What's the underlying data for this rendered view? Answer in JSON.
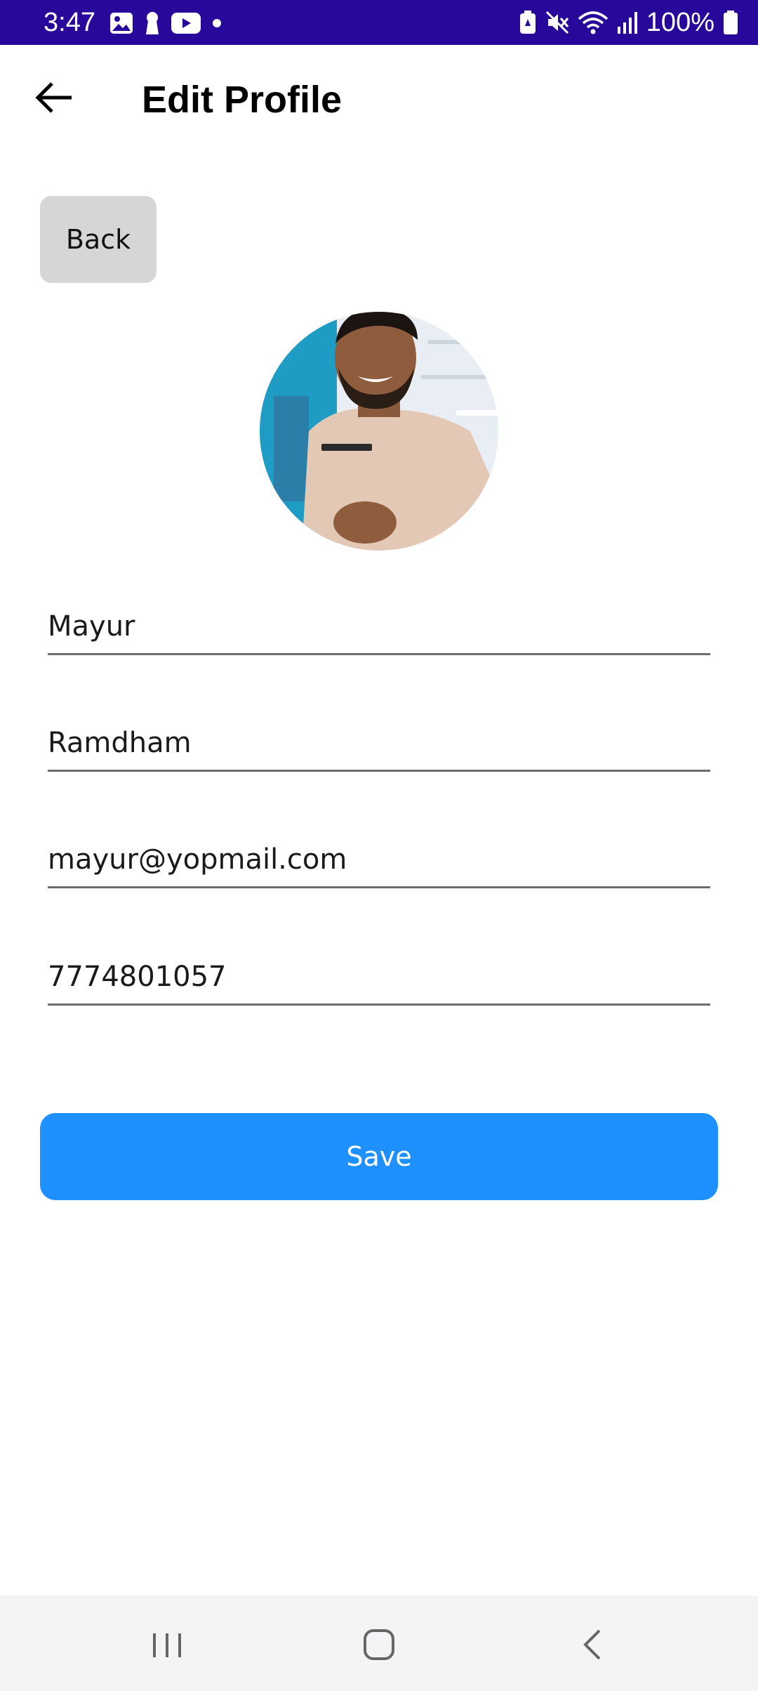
{
  "status_bar": {
    "time": "3:47",
    "battery": "100%",
    "left_icons": [
      "gallery-icon",
      "keyhole-icon",
      "youtube-icon",
      "dot-icon"
    ],
    "right_icons": [
      "battery-saver-icon",
      "mute-icon",
      "wifi-icon",
      "signal-icon",
      "battery-icon"
    ],
    "background": "#27089b"
  },
  "app_bar": {
    "title": "Edit Profile"
  },
  "back_button": {
    "label": "Back"
  },
  "form": {
    "first_name": "Mayur",
    "last_name": "Ramdham",
    "email": "mayur@yopmail.com",
    "phone": "7774801057"
  },
  "save_button": {
    "label": "Save",
    "color": "#1e90ff"
  },
  "nav_bar": {
    "items": [
      "recents-icon",
      "home-icon",
      "back-icon"
    ]
  }
}
